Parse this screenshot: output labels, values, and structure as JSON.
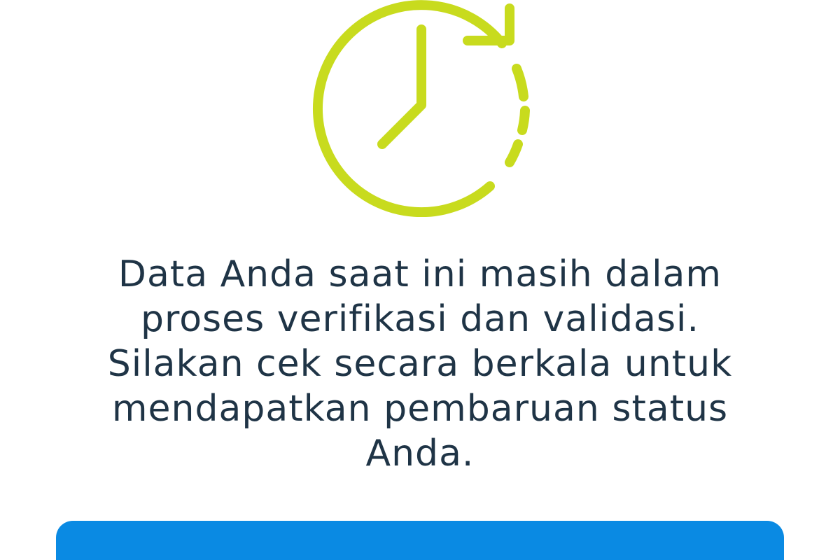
{
  "status": {
    "icon": "clock-refresh-icon",
    "message_lines": [
      "Data Anda saat ini masih dalam",
      "proses verifikasi dan validasi.",
      "Silakan cek secara berkala untuk",
      "mendapatkan pembaruan status",
      "Anda."
    ]
  },
  "actions": {
    "primary_button_label": ""
  },
  "colors": {
    "icon": "#c8db1e",
    "text": "#1f3446",
    "button": "#0a8ae3",
    "background": "#ffffff"
  }
}
